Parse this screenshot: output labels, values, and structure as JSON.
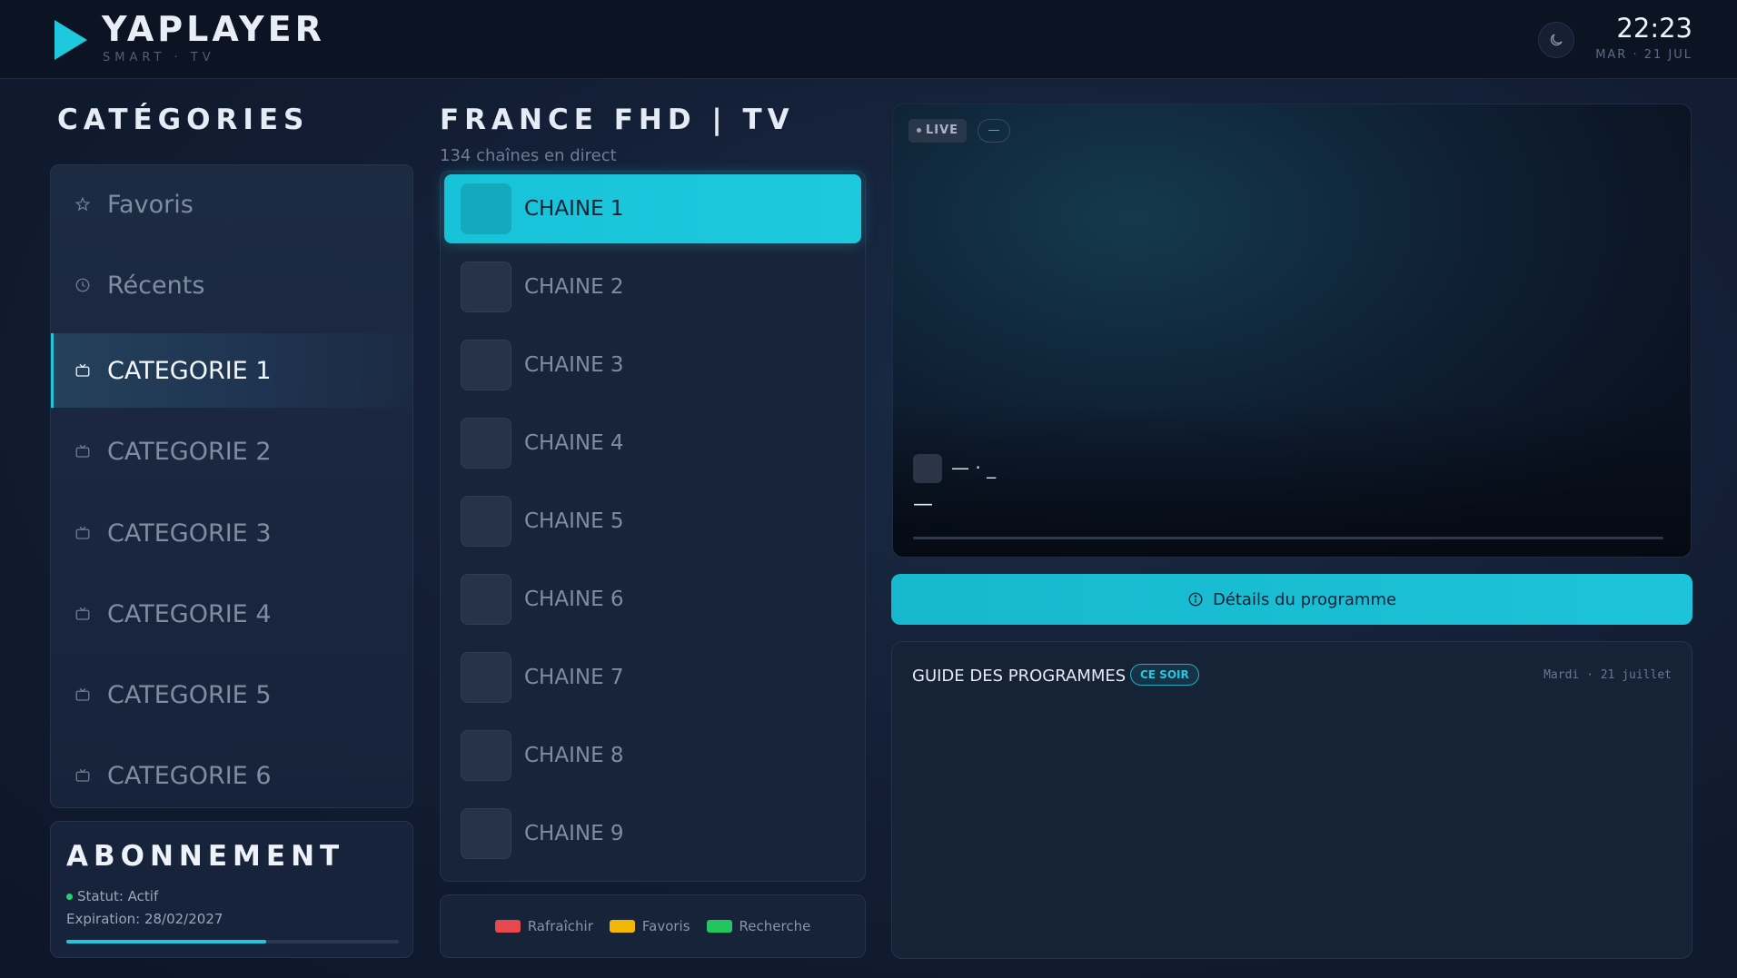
{
  "header": {
    "brand_name": "YAPLAYER",
    "brand_sub": "SMART · TV",
    "time": "22:23",
    "date": "MAR · 21 JUL"
  },
  "categories": {
    "title": "CATÉGORIES",
    "items": [
      {
        "label": "Favoris",
        "icon": "star-icon"
      },
      {
        "label": "Récents",
        "icon": "clock-icon"
      },
      {
        "label": "CATEGORIE 1",
        "icon": "tv-icon",
        "active": true
      },
      {
        "label": "CATEGORIE 2",
        "icon": "tv-icon"
      },
      {
        "label": "CATEGORIE 3",
        "icon": "tv-icon"
      },
      {
        "label": "CATEGORIE 4",
        "icon": "tv-icon"
      },
      {
        "label": "CATEGORIE 5",
        "icon": "tv-icon"
      },
      {
        "label": "CATEGORIE 6",
        "icon": "tv-icon"
      }
    ]
  },
  "subscription": {
    "title": "ABONNEMENT",
    "status": "Statut: Actif",
    "expiration": "Expiration: 28/02/2027",
    "progress_fraction": 0.6
  },
  "channels": {
    "title": "FRANCE FHD | TV",
    "subtitle": "134 chaînes en direct",
    "items": [
      {
        "label": "CHAINE 1",
        "active": true
      },
      {
        "label": "CHAINE 2"
      },
      {
        "label": "CHAINE 3"
      },
      {
        "label": "CHAINE 4"
      },
      {
        "label": "CHAINE 5"
      },
      {
        "label": "CHAINE 6"
      },
      {
        "label": "CHAINE 7"
      },
      {
        "label": "CHAINE 8"
      },
      {
        "label": "CHAINE 9"
      }
    ],
    "keys": [
      {
        "label": "Rafraîchir",
        "color": "#e5484d"
      },
      {
        "label": "Favoris",
        "color": "#f2b705"
      },
      {
        "label": "Recherche",
        "color": "#22c55e"
      }
    ]
  },
  "player": {
    "live_label": "LIVE",
    "secondary_badge": "—",
    "now_title": "— · _",
    "now_subtitle": "—",
    "progress_fraction": 0.0,
    "details_label": "Détails du programme"
  },
  "guide": {
    "title": "GUIDE DES PROGRAMMES",
    "badge": "CE SOIR",
    "date": "Mardi · 21 juillet"
  },
  "colors": {
    "accent": "#1ec9de",
    "background": "#121d33",
    "status_active": "#22d36b"
  }
}
